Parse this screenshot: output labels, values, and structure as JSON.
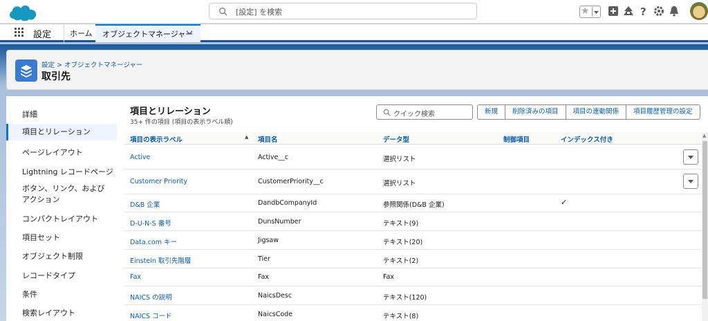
{
  "header": {
    "search_placeholder": "[設定] を検索"
  },
  "nav": {
    "app_name": "設定",
    "home_tab": "ホーム",
    "active_tab": "オブジェクトマネージャー"
  },
  "page_header": {
    "breadcrumb_1": "設定",
    "breadcrumb_sep": " > ",
    "breadcrumb_2": "オブジェクトマネージャー",
    "title": "取引先"
  },
  "sidebar": {
    "items": [
      {
        "label": "詳細"
      },
      {
        "label": "項目とリレーション"
      },
      {
        "label": "ページレイアウト"
      },
      {
        "label": "Lightning レコードページ"
      },
      {
        "label": "ボタン、リンク、およびアクション"
      },
      {
        "label": "コンパクトレイアウト"
      },
      {
        "label": "項目セット"
      },
      {
        "label": "オブジェクト制限"
      },
      {
        "label": "レコードタイプ"
      },
      {
        "label": "条件"
      },
      {
        "label": "検索レイアウト"
      }
    ]
  },
  "main": {
    "title": "項目とリレーション",
    "subtitle": "35+ 件の項目 (項目の表示ラベル順)",
    "quick_search_placeholder": "クイック検索",
    "buttons": [
      "新規",
      "削除済みの項目",
      "項目の連動関係",
      "項目履歴管理の設定"
    ],
    "columns": {
      "label": "項目の表示ラベル",
      "api": "項目名",
      "type": "データ型",
      "controlling": "制御項目",
      "indexed": "インデックス付き"
    },
    "rows": [
      {
        "label": "Active",
        "api": "Active__c",
        "type": "選択リスト",
        "indexed": "",
        "has_menu": true
      },
      {
        "label": "Customer Priority",
        "api": "CustomerPriority__c",
        "type": "選択リスト",
        "indexed": "",
        "has_menu": true
      },
      {
        "label": "D&B 企業",
        "api": "DandbCompanyId",
        "type": "参照関係(D&B 企業)",
        "indexed": "✓",
        "has_menu": false
      },
      {
        "label": "D-U-N-S 番号",
        "api": "DunsNumber",
        "type": "テキスト(9)",
        "indexed": "",
        "has_menu": false
      },
      {
        "label": "Data.com キー",
        "api": "Jigsaw",
        "type": "テキスト(20)",
        "indexed": "",
        "has_menu": false
      },
      {
        "label": "Einstein 取引先階層",
        "api": "Tier",
        "type": "テキスト(2)",
        "indexed": "",
        "has_menu": false
      },
      {
        "label": "Fax",
        "api": "Fax",
        "type": "Fax",
        "indexed": "",
        "has_menu": false
      },
      {
        "label": "NAICS の説明",
        "api": "NaicsDesc",
        "type": "テキスト(120)",
        "indexed": "",
        "has_menu": false
      },
      {
        "label": "NAICS コード",
        "api": "NaicsCode",
        "type": "テキスト(8)",
        "indexed": "",
        "has_menu": false
      }
    ]
  },
  "colors": {
    "brand_blue": "#0176d3",
    "link_blue": "#0b5cab",
    "header_band": "#1d5a9a"
  }
}
